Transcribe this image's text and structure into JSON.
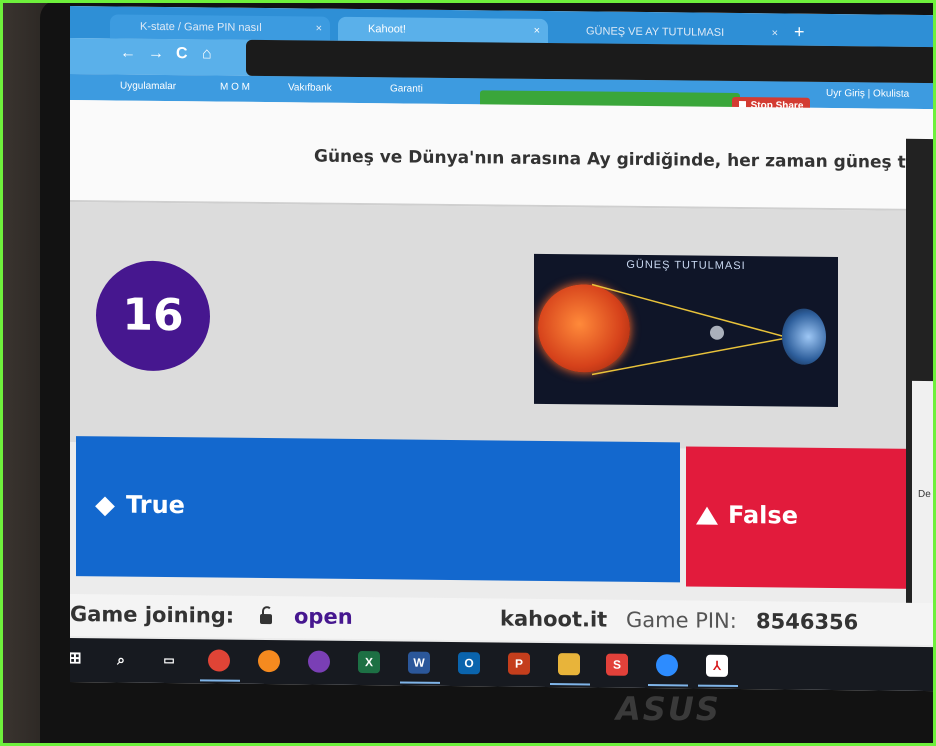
{
  "browser": {
    "tabs": [
      {
        "label": "K-state / Game PIN nasıl",
        "close": "×"
      },
      {
        "label": "Kahoot!",
        "close": "×"
      },
      {
        "label": "GÜNEŞ VE AY TUTULMASI",
        "close": "×"
      }
    ],
    "new_tab": "+",
    "nav": {
      "back": "←",
      "forward": "→",
      "reload": "C",
      "home": "⌂"
    },
    "bookmarks": [
      "Uygulamalar",
      "M O M",
      "Vakıfbank",
      "Garanti",
      "Uyr Giriş | Okulista"
    ],
    "share": {
      "viewing_text": "Stop Share",
      "viewers_text": "Stop Share"
    }
  },
  "question": {
    "text": "Güneş ve Dünya'nın arasına Ay girdiğinde, her zaman güneş tutuln"
  },
  "timer": {
    "value": "16"
  },
  "media": {
    "title": "GÜNEŞ TUTULMASI"
  },
  "answers": [
    {
      "label": "True",
      "shape": "diamond",
      "color": "#1368ce"
    },
    {
      "label": "False",
      "shape": "triangle",
      "color": "#e21b3c"
    }
  ],
  "footer": {
    "joining_label": "Game joining:",
    "joining_status": "open",
    "site": "kahoot.it",
    "pin_label": "Game PIN:",
    "pin_value": "8546356"
  },
  "side": {
    "text": "De"
  },
  "taskbar": {
    "icons": [
      "windows-start-icon",
      "search-icon",
      "task-view-icon",
      "chrome-icon",
      "firefox-icon",
      "tor-icon",
      "excel-icon",
      "word-icon",
      "outlook-icon",
      "powerpoint-icon",
      "file-explorer-icon",
      "s-app-icon",
      "zoom-icon",
      "acrobat-icon"
    ]
  },
  "device": {
    "brand": "ASUS"
  }
}
